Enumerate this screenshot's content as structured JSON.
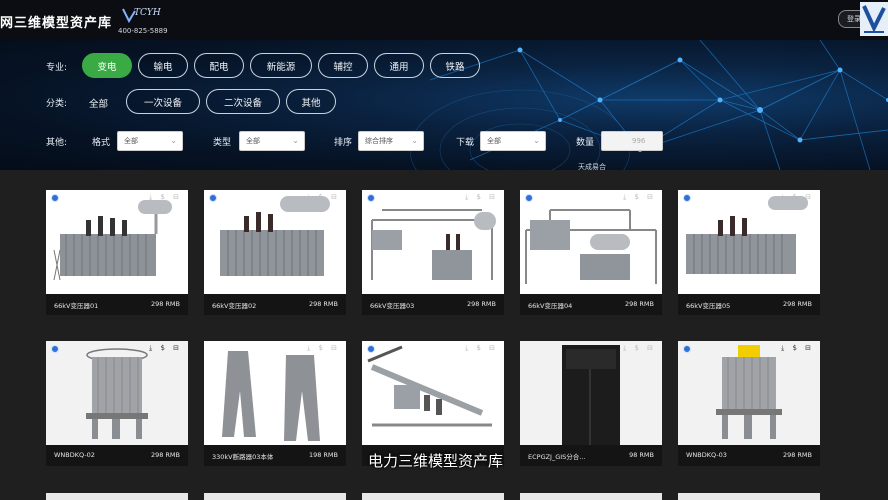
{
  "header": {
    "site_title": "网三维模型资产库",
    "logo_text": "TCYH",
    "phone": "400-825-5889",
    "login_label": "登录"
  },
  "filters": {
    "major_label": "专业:",
    "majors": [
      "变电",
      "输电",
      "配电",
      "新能源",
      "辅控",
      "通用",
      "铁路"
    ],
    "active_major": "变电",
    "category_label": "分类:",
    "category_all": "全部",
    "categories": [
      "一次设备",
      "二次设备",
      "其他"
    ],
    "other_label": "其他:",
    "format_label": "格式",
    "format_value": "全部",
    "type_label": "类型",
    "type_value": "全部",
    "sort_label": "排序",
    "sort_value": "综合排序",
    "download_label": "下载",
    "download_value": "全部",
    "quantity_label": "数量",
    "quantity_value": "996",
    "hint": "天成易合"
  },
  "cards": [
    {
      "name": "66kV变压器01",
      "price": "298 RMB"
    },
    {
      "name": "66kV变压器02",
      "price": "298 RMB"
    },
    {
      "name": "66kV变压器03",
      "price": "298 RMB"
    },
    {
      "name": "66kV变压器04",
      "price": "298 RMB"
    },
    {
      "name": "66kV变压器05",
      "price": "298 RMB"
    },
    {
      "name": "WNBDKQ-02",
      "price": "298 RMB"
    },
    {
      "name": "330kV断路器03本体",
      "price": "198 RMB"
    },
    {
      "name": "",
      "price": ""
    },
    {
      "name": "ECPGZJ_GIS分合...",
      "price": "98 RMB"
    },
    {
      "name": "WNBDKQ-03",
      "price": "298 RMB"
    }
  ],
  "card_tools": "⤓ $ ⊟",
  "subtitle": "电力三维模型资产库",
  "colors": {
    "accent_green": "#3aaa45",
    "hero_dark": "#061325",
    "page_bg": "#1f1f1f"
  }
}
